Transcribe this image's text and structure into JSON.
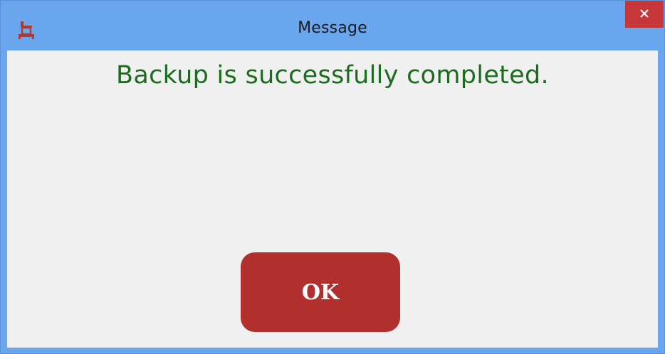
{
  "window": {
    "title": "Message",
    "close_glyph": "×",
    "app_icon": "computer-desk-icon",
    "colors": {
      "titlebar": "#6aa6ee",
      "close": "#c7373a",
      "client": "#f0f0f0"
    }
  },
  "dialog": {
    "message": "Backup is successfully completed.",
    "message_color": "#1c6b1f",
    "ok_label": "OK",
    "ok_color": "#b12f2d"
  }
}
